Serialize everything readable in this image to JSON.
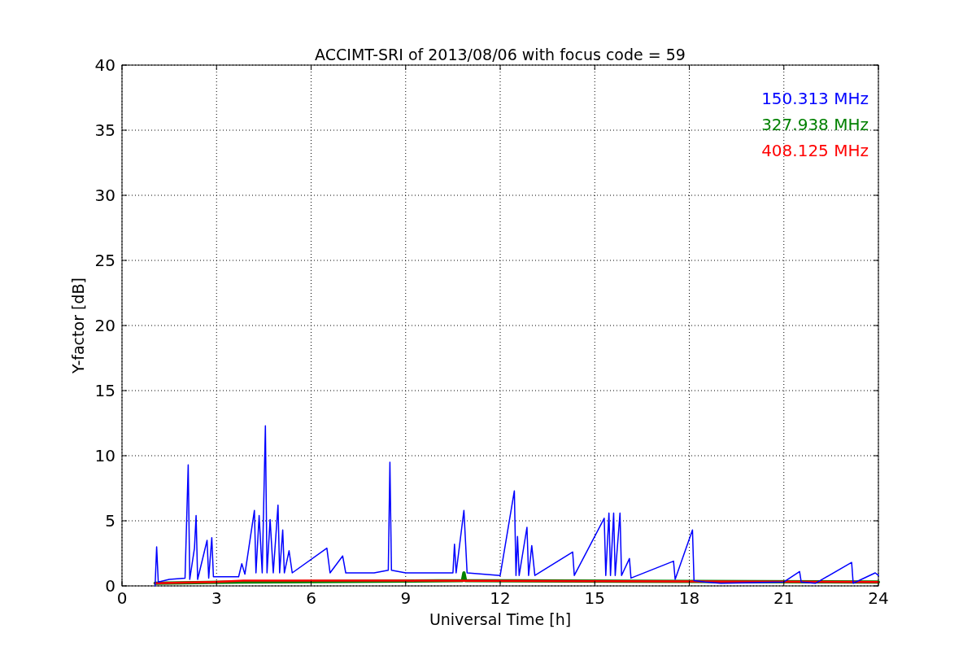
{
  "figure": {
    "chart_data": {
      "type": "line",
      "title": "ACCIMT-SRI of 2013/08/06 with focus code = 59",
      "xlabel": "Universal Time [h]",
      "ylabel": "Y-factor [dB]",
      "grid": true,
      "xlim": [
        0,
        24
      ],
      "ylim": [
        0,
        40
      ],
      "xticks": [
        0,
        3,
        6,
        9,
        12,
        15,
        18,
        21,
        24
      ],
      "yticks": [
        0,
        5,
        10,
        15,
        20,
        25,
        30,
        35,
        40
      ],
      "series": [
        {
          "name": "150.313 MHz",
          "color": "#0000ff",
          "x": [
            1.05,
            1.1,
            1.15,
            1.5,
            2.0,
            2.1,
            2.15,
            2.3,
            2.35,
            2.4,
            2.7,
            2.75,
            2.85,
            2.9,
            3.0,
            3.7,
            3.8,
            3.9,
            4.2,
            4.25,
            4.35,
            4.45,
            4.55,
            4.6,
            4.7,
            4.8,
            4.95,
            5.0,
            5.1,
            5.15,
            5.3,
            5.4,
            6.5,
            6.6,
            7.0,
            7.1,
            8.0,
            8.45,
            8.5,
            8.55,
            9.0,
            10.5,
            10.55,
            10.6,
            10.85,
            10.95,
            12.0,
            12.45,
            12.5,
            12.55,
            12.6,
            12.85,
            12.9,
            13.0,
            13.1,
            14.3,
            14.35,
            15.3,
            15.35,
            15.45,
            15.5,
            15.6,
            15.65,
            15.8,
            15.85,
            16.1,
            16.15,
            17.5,
            17.55,
            18.1,
            18.15,
            18.5,
            19.0,
            21.0,
            21.5,
            21.55,
            22.0,
            23.15,
            23.2,
            23.9,
            24.0
          ],
          "values": [
            0,
            3.0,
            0.3,
            0.5,
            0.6,
            9.3,
            0.5,
            2.9,
            5.4,
            0.5,
            3.5,
            0.6,
            3.7,
            0.7,
            0.7,
            0.7,
            1.7,
            0.9,
            5.8,
            1.0,
            5.4,
            1.0,
            12.3,
            1.0,
            5.1,
            1.0,
            6.2,
            1.0,
            4.3,
            1.0,
            2.7,
            1.0,
            2.9,
            1.0,
            2.3,
            1.0,
            1.0,
            1.2,
            9.5,
            1.2,
            1.0,
            1.0,
            3.2,
            1.0,
            5.8,
            1.0,
            0.8,
            7.3,
            0.8,
            3.8,
            0.8,
            4.5,
            0.8,
            3.1,
            0.8,
            2.6,
            0.8,
            5.2,
            0.8,
            5.6,
            0.8,
            5.6,
            0.8,
            5.6,
            0.8,
            2.1,
            0.6,
            1.9,
            0.5,
            4.3,
            0.4,
            0.3,
            0.2,
            0.3,
            1.1,
            0.3,
            0.2,
            1.8,
            0.2,
            1.0,
            0.8
          ]
        },
        {
          "name": "327.938 MHz",
          "color": "#008000",
          "x": [
            1.05,
            3.8,
            10.8,
            10.85,
            10.9,
            24.0
          ],
          "values": [
            0.2,
            0.3,
            0.4,
            1.0,
            0.4,
            0.3
          ]
        },
        {
          "name": "408.125 MHz",
          "color": "#ff0000",
          "x": [
            1.05,
            2.9,
            3.85,
            9.0,
            18.0,
            24.0
          ],
          "values": [
            0.2,
            0.3,
            0.4,
            0.4,
            0.35,
            0.3
          ]
        }
      ]
    }
  }
}
